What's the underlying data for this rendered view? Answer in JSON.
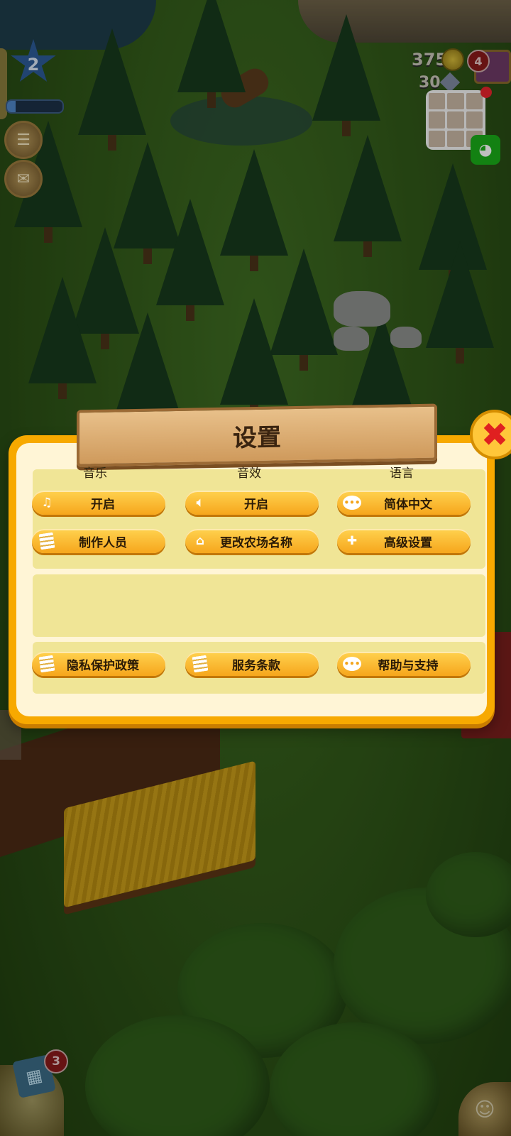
{
  "hud": {
    "level": "2",
    "xp_progress": 0.15,
    "coins": "375",
    "diamonds": "30",
    "gift_badge": "4",
    "cash_register_badge": "3"
  },
  "dialog": {
    "title": "设置",
    "columns": {
      "music_label": "音乐",
      "sfx_label": "音效",
      "language_label": "语言"
    },
    "buttons": {
      "music": "开启",
      "sfx": "开启",
      "language": "简体中文",
      "credits": "制作人员",
      "rename_farm": "更改农场名称",
      "advanced": "高级设置",
      "privacy": "隐私保护政策",
      "terms": "服务条款",
      "help": "帮助与支持"
    },
    "icons": {
      "music": "music-note-icon",
      "sfx": "speaker-icon",
      "language": "speech-bubble-icon",
      "credits": "document-icon",
      "rename_farm": "house-icon",
      "advanced": "plus-icon",
      "privacy": "document-icon",
      "terms": "document-icon",
      "help": "speech-bubble-icon"
    }
  }
}
